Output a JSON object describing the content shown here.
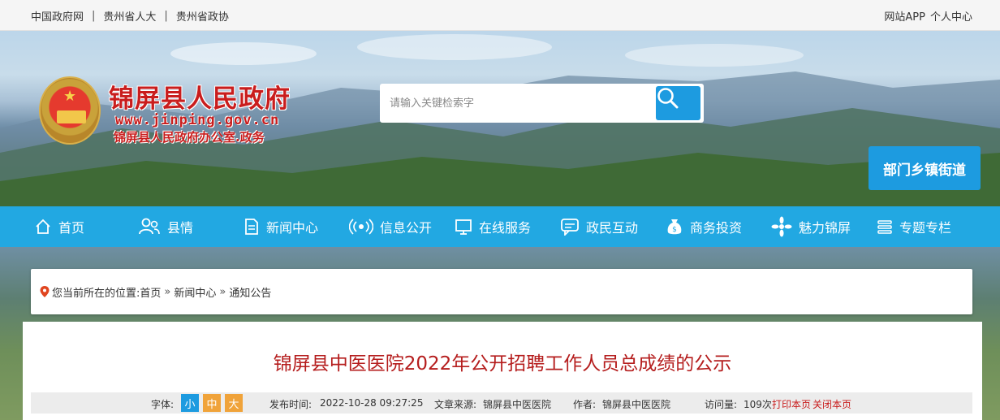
{
  "topbar": {
    "links": [
      "中国政府网",
      "贵州省人大",
      "贵州省政协"
    ],
    "separator": "|",
    "right_links": [
      "网站APP",
      "个人中心"
    ]
  },
  "logo": {
    "title": "锦屏县人民政府",
    "url": "www.jinping.gov.cn",
    "subtitle": "锦屏县人民政府办公室.政务"
  },
  "search": {
    "placeholder": "请输入关键检索字"
  },
  "dept_button": "部门乡镇街道",
  "nav": {
    "items": [
      "首页",
      "县情",
      "新闻中心",
      "信息公开",
      "在线服务",
      "政民互动",
      "商务投资",
      "魅力锦屏",
      "专题专栏"
    ]
  },
  "breadcrumb": {
    "prefix": "您当前所在的位置:",
    "items": [
      "首页",
      "新闻中心",
      "通知公告"
    ],
    "separator": "»"
  },
  "article": {
    "title": "锦屏县中医医院2022年公开招聘工作人员总成绩的公示",
    "meta": {
      "font_label": "字体:",
      "font_sizes": [
        "小",
        "中",
        "大"
      ],
      "publish_label": "发布时间:",
      "publish_time": "2022-10-28 09:27:25",
      "source_label": "文章来源:",
      "source": "锦屏县中医医院",
      "author_label": "作者:",
      "author": "锦屏县中医医院",
      "visits_label": "访问量:",
      "visits": "109次",
      "print_link": "打印本页",
      "close_link": "关闭本页"
    }
  },
  "colors": {
    "nav_bg": "#22a8e2",
    "accent_blue": "#1d9be0",
    "title_red": "#b51d1d",
    "font_small": "#1d9be0",
    "font_mid": "#f0a33a",
    "font_large": "#f0a33a"
  }
}
